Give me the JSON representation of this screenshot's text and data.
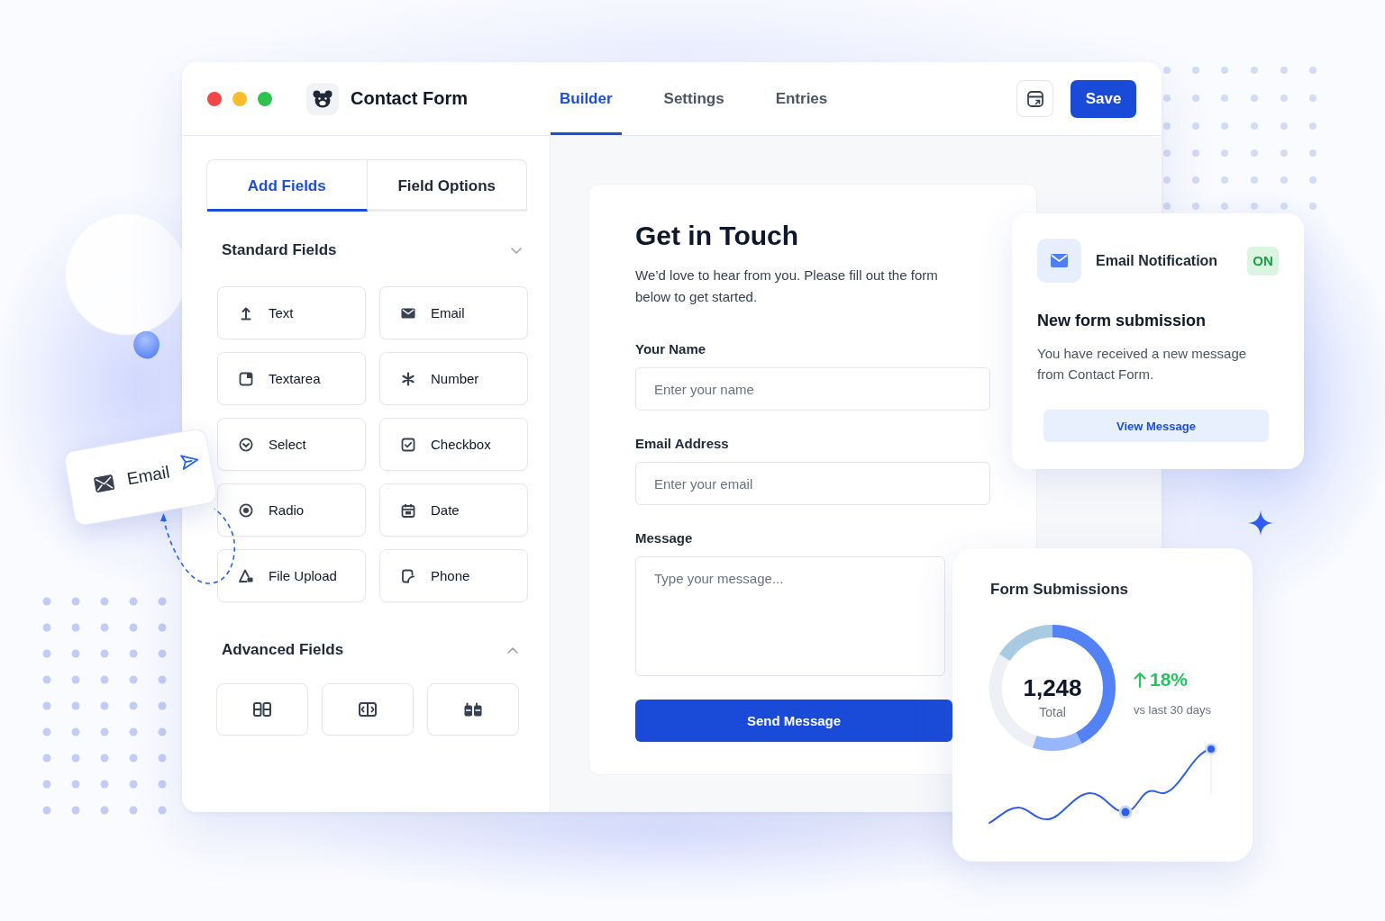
{
  "window": {
    "traffic_lights": [
      {
        "color": "#f04747"
      },
      {
        "color": "#fbbc2c"
      },
      {
        "color": "#2fc24f"
      }
    ],
    "title": "Contact Form",
    "tabs": [
      {
        "label": "Builder",
        "selected": true
      },
      {
        "label": "Settings",
        "selected": false
      },
      {
        "label": "Entries",
        "selected": false
      }
    ],
    "save_button": "Save"
  },
  "sidebar": {
    "tabs": [
      {
        "label": "Add Fields",
        "selected": true
      },
      {
        "label": "Field Options",
        "selected": false
      }
    ],
    "sections": [
      {
        "title": "Standard Fields",
        "chevron_up": false,
        "kind": "list",
        "fields": [
          {
            "kind": "text",
            "label": "Text"
          },
          {
            "kind": "email",
            "label": "Email"
          },
          {
            "kind": "textarea",
            "label": "Textarea"
          },
          {
            "kind": "number",
            "label": "Number"
          },
          {
            "kind": "select",
            "label": "Select"
          },
          {
            "kind": "checkbox",
            "label": "Checkbox"
          },
          {
            "kind": "radio",
            "label": "Radio"
          },
          {
            "kind": "date",
            "label": "Date"
          },
          {
            "kind": "file_upload",
            "label": "File Upload"
          },
          {
            "kind": "phone",
            "label": "Phone"
          }
        ]
      },
      {
        "title": "Advanced Fields",
        "chevron_up": true,
        "kind": "icons",
        "fields": [
          {
            "kind": "columns"
          },
          {
            "kind": "split"
          },
          {
            "kind": "blocks"
          }
        ]
      }
    ]
  },
  "dragged_field": {
    "label": "Email"
  },
  "form_preview": {
    "title": "Get in Touch",
    "description": "We’d love to hear from you. Please fill out the form below to get started.",
    "fields": [
      {
        "kind": "input",
        "label": "Your Name",
        "placeholder": "Enter your name"
      },
      {
        "kind": "input",
        "label": "Email Address",
        "placeholder": "Enter your email"
      },
      {
        "kind": "textarea",
        "label": "Message",
        "placeholder": "Type your message..."
      }
    ],
    "submit_button": "Send Message"
  },
  "notification_card": {
    "title": "Email Notification",
    "badge": "ON",
    "heading": "New form submission",
    "message": "You have received a new message from Contact Form.",
    "button": "View Message"
  },
  "submissions_card": {
    "title": "Form Submissions",
    "total": "1,248",
    "total_label": "Total",
    "change": "18%",
    "period": "vs last 30 days"
  }
}
